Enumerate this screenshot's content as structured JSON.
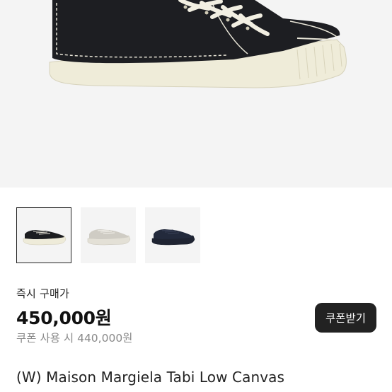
{
  "product": {
    "images": [
      {
        "icon": "black-sneaker",
        "selected": true
      },
      {
        "icon": "white-sneaker",
        "selected": false
      },
      {
        "icon": "navy-sneaker",
        "selected": false
      }
    ],
    "purchase_label": "즉시 구매가",
    "price": "450,000원",
    "coupon_price_text": "쿠폰 사용 시 440,000원",
    "coupon_button_label": "쿠폰받기",
    "title": "(W) Maison Margiela Tabi Low Canvas"
  },
  "colors": {
    "accent_dark": "#222222",
    "muted_text": "#8a8a8a",
    "image_bg": "#f4f4f4"
  }
}
